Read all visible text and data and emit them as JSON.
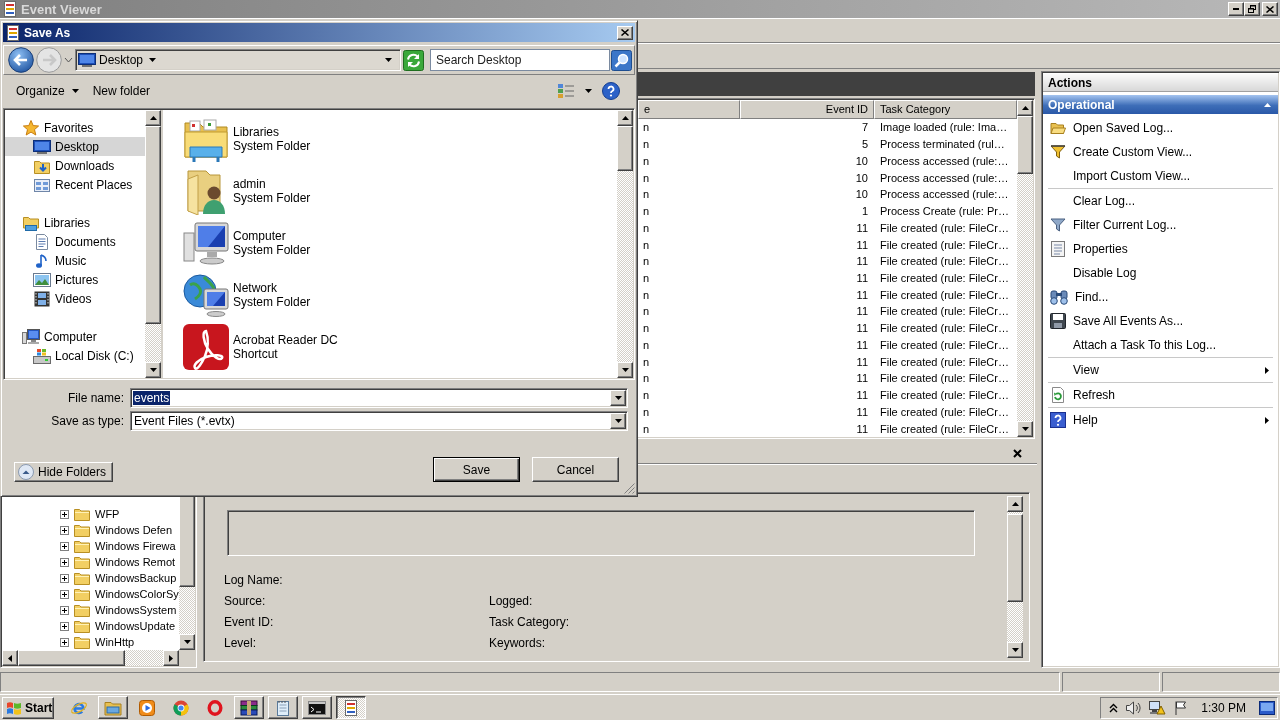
{
  "main_window": {
    "title": "Event Viewer",
    "tree": {
      "items": [
        {
          "label": "WFP",
          "expanded": false
        },
        {
          "label": "Windows Defen",
          "expanded": false
        },
        {
          "label": "Windows Firewa",
          "expanded": false
        },
        {
          "label": "Windows Remot",
          "expanded": false
        },
        {
          "label": "WindowsBackup",
          "expanded": false
        },
        {
          "label": "WindowsColorSy",
          "expanded": false
        },
        {
          "label": "WindowsSystem",
          "expanded": false
        },
        {
          "label": "WindowsUpdate",
          "expanded": false
        },
        {
          "label": "WinHttp",
          "expanded": false
        }
      ]
    },
    "events_table": {
      "columns": [
        "e",
        "Event ID",
        "Task Category"
      ],
      "rows": [
        [
          "n",
          "7",
          "Image loaded (rule: Ima…"
        ],
        [
          "n",
          "5",
          "Process terminated (rul…"
        ],
        [
          "n",
          "10",
          "Process accessed (rule:…"
        ],
        [
          "n",
          "10",
          "Process accessed (rule:…"
        ],
        [
          "n",
          "10",
          "Process accessed (rule:…"
        ],
        [
          "n",
          "1",
          "Process Create (rule: Pr…"
        ],
        [
          "n",
          "11",
          "File created (rule: FileCr…"
        ],
        [
          "n",
          "11",
          "File created (rule: FileCr…"
        ],
        [
          "n",
          "11",
          "File created (rule: FileCr…"
        ],
        [
          "n",
          "11",
          "File created (rule: FileCr…"
        ],
        [
          "n",
          "11",
          "File created (rule: FileCr…"
        ],
        [
          "n",
          "11",
          "File created (rule: FileCr…"
        ],
        [
          "n",
          "11",
          "File created (rule: FileCr…"
        ],
        [
          "n",
          "11",
          "File created (rule: FileCr…"
        ],
        [
          "n",
          "11",
          "File created (rule: FileCr…"
        ],
        [
          "n",
          "11",
          "File created (rule: FileCr…"
        ],
        [
          "n",
          "11",
          "File created (rule: FileCr…"
        ],
        [
          "n",
          "11",
          "File created (rule: FileCr…"
        ],
        [
          "n",
          "11",
          "File created (rule: FileCr…"
        ]
      ]
    },
    "details": {
      "fields": [
        [
          "Log Name:"
        ],
        [
          "Source:",
          "Logged:"
        ],
        [
          "Event ID:",
          "Task Category:"
        ],
        [
          "Level:",
          "Keywords:"
        ]
      ]
    },
    "actions": {
      "title": "Actions",
      "section": {
        "title": "Operational",
        "expanded": true
      },
      "groups": [
        [
          {
            "label": "Open Saved Log...",
            "submenu": false
          },
          {
            "label": "Create Custom View...",
            "submenu": false
          },
          {
            "label": "Import Custom View...",
            "submenu": false
          }
        ],
        [
          {
            "label": "Clear Log...",
            "submenu": false
          },
          {
            "label": "Filter Current Log...",
            "submenu": false
          },
          {
            "label": "Properties",
            "submenu": false
          },
          {
            "label": "Disable Log",
            "submenu": false
          },
          {
            "label": "Find...",
            "submenu": false
          },
          {
            "label": "Save All Events As...",
            "submenu": false
          },
          {
            "label": "Attach a Task To this Log...",
            "submenu": false
          }
        ],
        [
          {
            "label": "View",
            "submenu": true
          }
        ],
        [
          {
            "label": "Refresh",
            "submenu": false
          }
        ],
        [
          {
            "label": "Help",
            "submenu": true
          }
        ]
      ]
    }
  },
  "save_as_dialog": {
    "title": "Save As",
    "location": "Desktop",
    "search": {
      "placeholder": "Search Desktop"
    },
    "toolbar": {
      "organize": "Organize",
      "new_folder": "New folder"
    },
    "navigation": [
      {
        "label": "Favorites",
        "selected": false,
        "children": [
          {
            "label": "Desktop",
            "selected": true
          },
          {
            "label": "Downloads",
            "selected": false
          },
          {
            "label": "Recent Places",
            "selected": false
          }
        ]
      },
      {
        "label": "Libraries",
        "selected": false,
        "children": [
          {
            "label": "Documents",
            "selected": false
          },
          {
            "label": "Music",
            "selected": false
          },
          {
            "label": "Pictures",
            "selected": false
          },
          {
            "label": "Videos",
            "selected": false
          }
        ]
      },
      {
        "label": "Computer",
        "selected": false,
        "children": [
          {
            "label": "Local Disk (C:)",
            "selected": false
          }
        ]
      }
    ],
    "files": [
      {
        "name": "Libraries",
        "type": "System Folder",
        "selected": false
      },
      {
        "name": "admin",
        "type": "System Folder",
        "selected": false
      },
      {
        "name": "Computer",
        "type": "System Folder",
        "selected": false
      },
      {
        "name": "Network",
        "type": "System Folder",
        "selected": false
      },
      {
        "name": "Acrobat Reader DC",
        "type": "Shortcut",
        "selected": false
      }
    ],
    "file_name": {
      "label": "File name:",
      "value": "events",
      "text_selected": true
    },
    "save_as_type": {
      "label": "Save as type:",
      "value": "Event Files (*.evtx)"
    },
    "hide_folders": "Hide Folders",
    "buttons": [
      {
        "label": "Save",
        "default": true
      },
      {
        "label": "Cancel",
        "default": false
      }
    ]
  },
  "taskbar": {
    "start": "Start",
    "apps": [
      {
        "running": false,
        "selected": false
      },
      {
        "running": true,
        "selected": false
      },
      {
        "running": false,
        "selected": false
      },
      {
        "running": false,
        "selected": false
      },
      {
        "running": false,
        "selected": false
      },
      {
        "running": true,
        "selected": false
      },
      {
        "running": true,
        "selected": false
      },
      {
        "running": true,
        "selected": false
      },
      {
        "running": true,
        "selected": true
      }
    ],
    "clock": "1:30 PM"
  }
}
